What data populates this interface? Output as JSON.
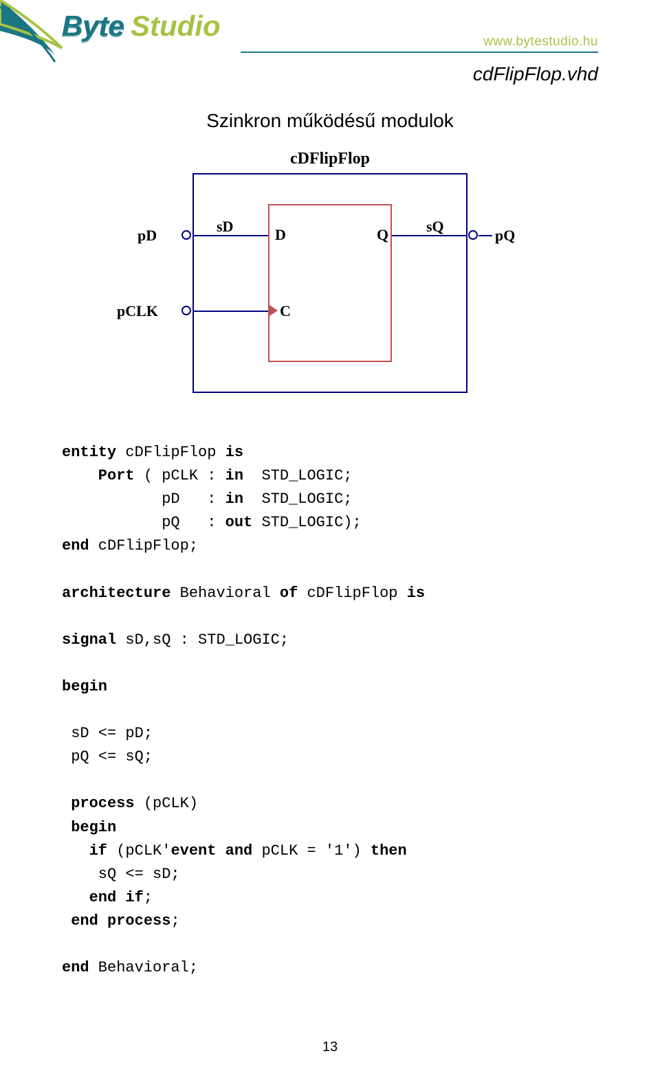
{
  "header": {
    "url": "www.bytestudio.hu",
    "filename": "cdFlipFlop.vhd",
    "logo_byte": "Byte",
    "logo_studio": "Studio"
  },
  "section_title": "Szinkron működésű modulok",
  "diagram": {
    "title": "cDFlipFlop",
    "pD": "pD",
    "pCLK": "pCLK",
    "pQ": "pQ",
    "sD": "sD",
    "sQ": "sQ",
    "D": "D",
    "Q": "Q",
    "C": "C"
  },
  "code": {
    "l1a": "entity",
    "l1b": " cDFlipFlop ",
    "l1c": "is",
    "l2a": "    Port",
    "l2b": " ( pCLK : ",
    "l2c": "in",
    "l2d": "  STD_LOGIC;",
    "l3a": "           pD   : ",
    "l3b": "in",
    "l3c": "  STD_LOGIC;",
    "l4a": "           pQ   : ",
    "l4b": "out",
    "l4c": " STD_LOGIC);",
    "l5a": "end",
    "l5b": " cDFlipFlop;",
    "l6a": "architecture",
    "l6b": " Behavioral ",
    "l6c": "of",
    "l6d": " cDFlipFlop ",
    "l6e": "is",
    "l7a": "signal",
    "l7b": " sD,sQ : STD_LOGIC;",
    "l8": "begin",
    "l9": " sD <= pD;",
    "l10": " pQ <= sQ;",
    "l11a": " process",
    "l11b": " (pCLK)",
    "l12": " begin",
    "l13a": "   if",
    "l13b": " (pCLK'",
    "l13c": "event and",
    "l13d": " pCLK = '1') ",
    "l13e": "then",
    "l14": "    sQ <= sD;",
    "l15a": "   end if",
    "l15b": ";",
    "l16a": " end process",
    "l16b": ";",
    "l17a": "end",
    "l17b": " Behavioral;"
  },
  "page_number": "13"
}
